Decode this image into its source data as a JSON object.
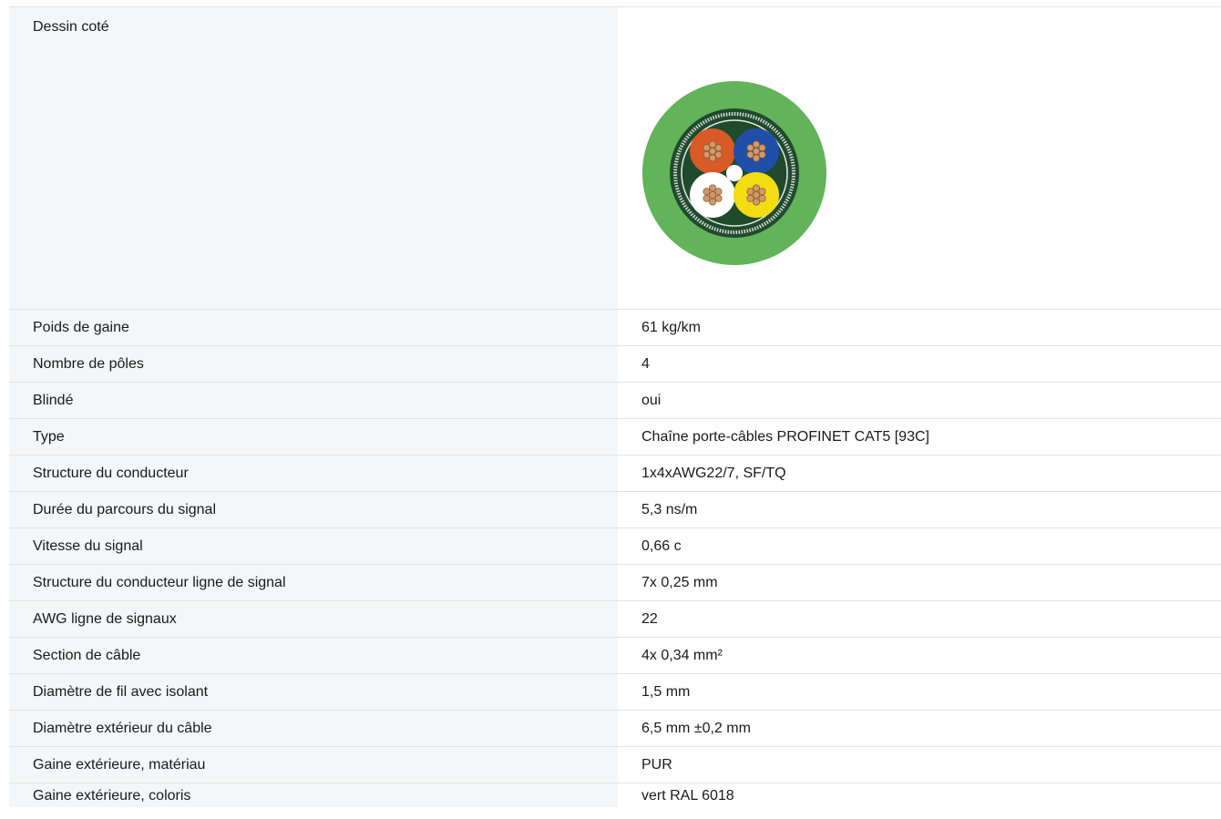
{
  "drawing": {
    "label": "Dessin coté",
    "image_icon": "cable-cross-section-icon",
    "colors": {
      "sheath": "#62b35a",
      "inner": "#1f4a2c",
      "shield": "#d9d9d9",
      "core_orange": "#d85a26",
      "core_blue": "#1f4fa8",
      "core_white": "#ffffff",
      "core_yellow": "#f2dc12",
      "copper": "#d29a6a"
    }
  },
  "rows": [
    {
      "label": "Poids de gaine",
      "value": "61 kg/km"
    },
    {
      "label": "Nombre de pôles",
      "value": "4"
    },
    {
      "label": "Blindé",
      "value": "oui"
    },
    {
      "label": "Type",
      "value": "Chaîne porte-câbles PROFINET CAT5 [93C]"
    },
    {
      "label": "Structure du conducteur",
      "value": "1x4xAWG22/7, SF/TQ"
    },
    {
      "label": "Durée du parcours du signal",
      "value": "5,3 ns/m"
    },
    {
      "label": "Vitesse du signal",
      "value": "0,66 c"
    },
    {
      "label": "Structure du conducteur ligne de signal",
      "value": "7x 0,25 mm"
    },
    {
      "label": "AWG ligne de signaux",
      "value": "22"
    },
    {
      "label": "Section de câble",
      "value": "4x 0,34 mm²"
    },
    {
      "label": "Diamètre de fil avec isolant",
      "value": "1,5 mm"
    },
    {
      "label": "Diamètre extérieur du câble",
      "value": "6,5 mm ±0,2 mm"
    },
    {
      "label": "Gaine extérieure, matériau",
      "value": "PUR"
    },
    {
      "label": "Gaine extérieure, coloris",
      "value": "vert RAL 6018"
    }
  ]
}
